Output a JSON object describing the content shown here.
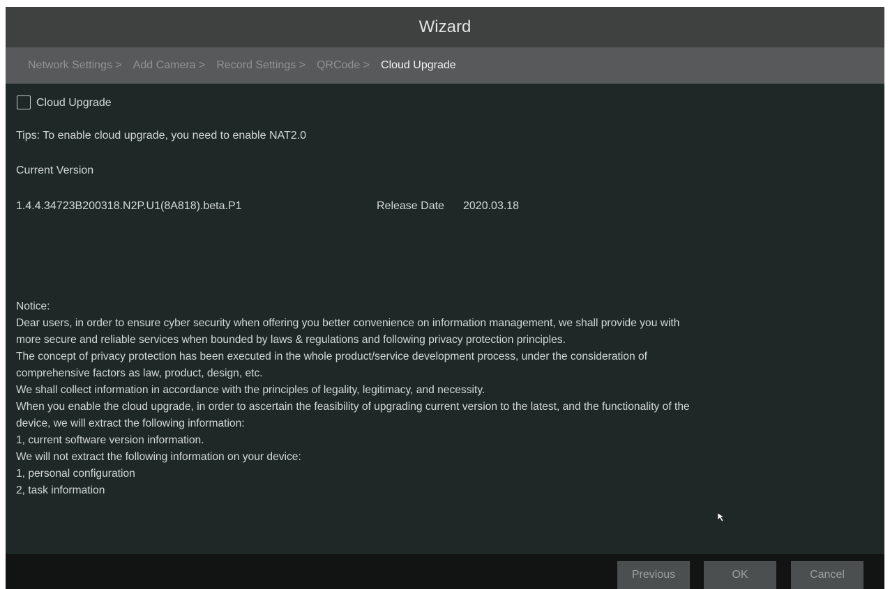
{
  "window": {
    "title": "Wizard"
  },
  "steps": [
    {
      "label": "Network Settings >"
    },
    {
      "label": "Add Camera >"
    },
    {
      "label": "Record Settings >"
    },
    {
      "label": "QRCode >"
    },
    {
      "label": "Cloud Upgrade"
    }
  ],
  "cloud_upgrade": {
    "checkbox_label": "Cloud Upgrade",
    "checked": false,
    "tips": "Tips: To enable cloud upgrade, you need to enable NAT2.0",
    "current_version_label": "Current Version",
    "version": "1.4.4.34723B200318.N2P.U1(8A818).beta.P1",
    "release_date_label": "Release Date",
    "release_date": "2020.03.18"
  },
  "notice": {
    "lines": [
      "Notice:",
      "Dear users, in order to ensure cyber security when offering you better convenience on information management, we shall provide you with",
      "more secure and reliable services when bounded by laws & regulations and following privacy protection principles.",
      "The concept of privacy protection has been executed in the whole product/service development process, under the consideration of",
      "comprehensive factors as law, product, design, etc.",
      "We shall collect information in accordance with the principles of legality, legitimacy, and necessity.",
      "When you enable the cloud upgrade, in order to ascertain the feasibility of upgrading current version to the latest, and the functionality of the",
      "device, we will extract the following information:",
      "1, current software version information.",
      "We will not extract the following information on your device:",
      "1, personal configuration",
      "2, task information"
    ]
  },
  "footer": {
    "previous_label": "Previous",
    "ok_label": "OK",
    "cancel_label": "Cancel"
  },
  "colors": {
    "content_background": "#1e2927",
    "title_bar": "#3f4140",
    "steps_bar": "#57595a",
    "footer": "#121313",
    "button": "#4c4f50"
  }
}
